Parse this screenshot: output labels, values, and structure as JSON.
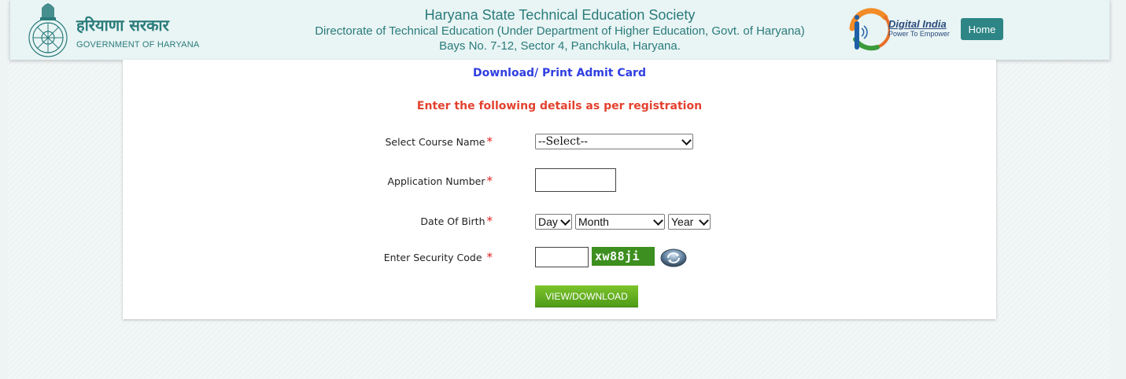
{
  "header": {
    "gov_hindi": "हरियाणा सरकार",
    "gov_english": "GOVERNMENT OF HARYANA",
    "org_title": "Haryana State Technical Education Society",
    "org_line1": "Directorate of Technical Education (Under Department of Higher Education, Govt. of Haryana)",
    "org_line2": "Bays No. 7-12, Sector 4, Panchkula, Haryana.",
    "digital_india_title": "Digital India",
    "digital_india_tagline": "Power To Empower",
    "home_label": "Home"
  },
  "form": {
    "title": "Download/ Print Admit Card",
    "instruction": "Enter the following details as per registration",
    "required_mark": "*",
    "course": {
      "label": "Select Course Name",
      "value": "--Select--"
    },
    "application": {
      "label": "Application Number",
      "value": ""
    },
    "dob": {
      "label": "Date Of Birth",
      "day": "Day",
      "month": "Month",
      "year": "Year"
    },
    "security": {
      "label": "Enter Security Code ",
      "value": "",
      "captcha": "xw88ji"
    },
    "submit_label": "VIEW/DOWNLOAD"
  },
  "colors": {
    "teal": "#2a7b7b",
    "title_blue": "#2f3ee0",
    "instruction_red": "#e3412f",
    "button_green": "#5aa81e",
    "home_button": "#2e8585"
  },
  "icons": {
    "emblem": "haryana-emblem-icon",
    "digital_india": "digital-india-logo-icon",
    "refresh": "refresh-captcha-icon"
  }
}
